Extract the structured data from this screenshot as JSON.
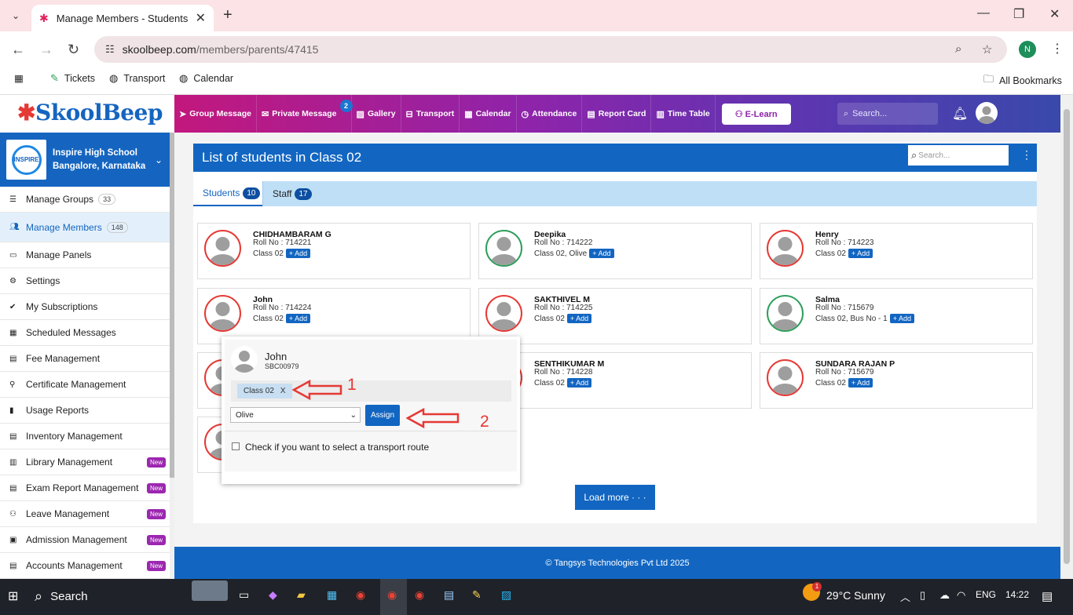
{
  "browser": {
    "tab_title": "Manage Members - Students",
    "url_host": "skoolbeep.com",
    "url_path": "/members/parents/47415",
    "profile_initial": "N",
    "bookmarks": [
      "Tickets",
      "Transport",
      "Calendar"
    ],
    "all_bookmarks": "All Bookmarks"
  },
  "app": {
    "logo": "SkoolBeep",
    "nav": [
      {
        "label": "Group Message",
        "icon": "send-icon"
      },
      {
        "label": "Private Message",
        "icon": "mail-icon",
        "badge": "2"
      },
      {
        "label": "Gallery",
        "icon": "image-icon"
      },
      {
        "label": "Transport",
        "icon": "bus-icon"
      },
      {
        "label": "Calendar",
        "icon": "calendar-icon"
      },
      {
        "label": "Attendance",
        "icon": "clock-icon"
      },
      {
        "label": "Report Card",
        "icon": "document-icon"
      },
      {
        "label": "Time Table",
        "icon": "table-icon"
      }
    ],
    "elearn": "E-Learn",
    "search_placeholder": "Search..."
  },
  "sidebar": {
    "school_name": "Inspire High School",
    "school_location": "Bangalore, Karnataka",
    "school_logo_text": "INSPIRE",
    "items": [
      {
        "label": "Manage Groups",
        "count": "33"
      },
      {
        "label": "Manage Members",
        "count": "148",
        "active": true
      },
      {
        "label": "Manage Panels"
      },
      {
        "label": "Settings"
      },
      {
        "label": "My Subscriptions"
      },
      {
        "label": "Scheduled Messages"
      },
      {
        "label": "Fee Management"
      },
      {
        "label": "Certificate Management"
      },
      {
        "label": "Usage Reports"
      },
      {
        "label": "Inventory Management"
      },
      {
        "label": "Library Management",
        "new": "New"
      },
      {
        "label": "Exam Report Management",
        "new": "New"
      },
      {
        "label": "Leave Management",
        "new": "New"
      },
      {
        "label": "Admission Management",
        "new": "New"
      },
      {
        "label": "Accounts Management",
        "new": "New"
      }
    ]
  },
  "main": {
    "title": "List of students in Class 02",
    "search_placeholder": "Search...",
    "tabs": [
      {
        "label": "Students",
        "count": "10"
      },
      {
        "label": "Staff",
        "count": "17"
      }
    ],
    "add_label": "+ Add",
    "students": [
      {
        "name": "CHIDHAMBARAM G",
        "roll": "Roll No : 714221",
        "class": "Class 02",
        "ring": "red"
      },
      {
        "name": "Deepika",
        "roll": "Roll No : 714222",
        "class": "Class 02, Olive",
        "ring": "green"
      },
      {
        "name": "Henry",
        "roll": "Roll No : 714223",
        "class": "Class 02",
        "ring": "red"
      },
      {
        "name": "John",
        "roll": "Roll No : 714224",
        "class": "Class 02",
        "ring": "red"
      },
      {
        "name": "SAKTHIVEL M",
        "roll": "Roll No : 714225",
        "class": "Class 02",
        "ring": "red"
      },
      {
        "name": "Salma",
        "roll": "Roll No : 715679",
        "class": "Class 02, Bus No - 1",
        "ring": "green"
      },
      {
        "name": "SENTHIKUMAR M",
        "roll": "Roll No : 714228",
        "class": "Class 02",
        "ring": "red"
      },
      {
        "name": "SUNDARA RAJAN P",
        "roll": "Roll No : 715679",
        "class": "Class 02",
        "ring": "red"
      }
    ],
    "load_more": "Load more · · ·"
  },
  "popup": {
    "name": "John",
    "id": "SBC00979",
    "chip": "Class 02",
    "chip_remove": "X",
    "select_value": "Olive",
    "assign": "Assign",
    "transport_label": "Check if you want to select a transport route",
    "annotation_1": "1",
    "annotation_2": "2"
  },
  "footer": "© Tangsys Technologies Pvt Ltd 2025",
  "taskbar": {
    "search": "Search",
    "weather": "29°C  Sunny",
    "lang": "ENG",
    "time": "14:22",
    "weather_badge": "1"
  }
}
